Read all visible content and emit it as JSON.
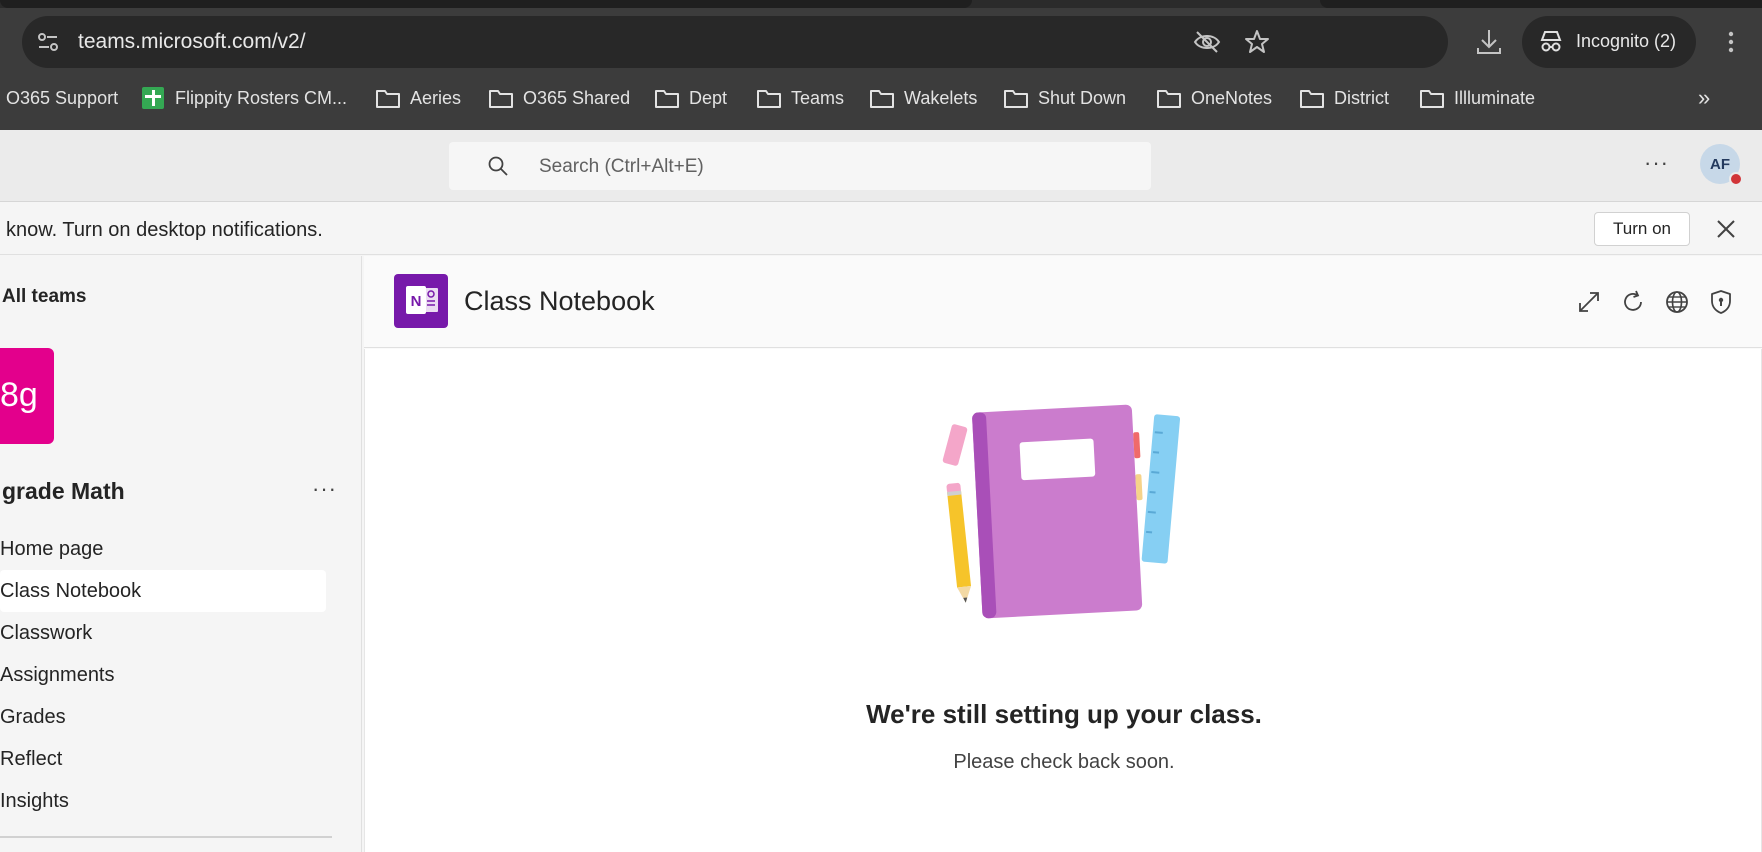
{
  "browser": {
    "url": "teams.microsoft.com/v2/",
    "incognito_label": "Incognito (2)",
    "bookmarks": [
      {
        "label": "O365 Support",
        "icon": "none"
      },
      {
        "label": "Flippity Rosters CM...",
        "icon": "sheets-icon"
      },
      {
        "label": "Aeries",
        "icon": "folder-icon"
      },
      {
        "label": "O365 Shared",
        "icon": "folder-icon"
      },
      {
        "label": "Dept",
        "icon": "folder-icon"
      },
      {
        "label": "Teams",
        "icon": "folder-icon"
      },
      {
        "label": "Wakelets",
        "icon": "folder-icon"
      },
      {
        "label": "Shut Down",
        "icon": "folder-icon"
      },
      {
        "label": "OneNotes",
        "icon": "folder-icon"
      },
      {
        "label": "District",
        "icon": "folder-icon"
      },
      {
        "label": "Illluminate",
        "icon": "folder-icon"
      }
    ],
    "overflow_label": "»"
  },
  "teams_header": {
    "search_placeholder": "Search (Ctrl+Alt+E)",
    "more_label": "···",
    "avatar_initials": "AF"
  },
  "banner": {
    "text": "know. Turn on desktop notifications.",
    "turn_on_label": "Turn on"
  },
  "left_pane": {
    "all_teams_label": "All teams",
    "team_tile_text": "8g",
    "team_name": "grade Math",
    "team_more_label": "···",
    "nav": [
      {
        "label": "Home page",
        "selected": false
      },
      {
        "label": "Class Notebook",
        "selected": true
      },
      {
        "label": "Classwork",
        "selected": false
      },
      {
        "label": "Assignments",
        "selected": false
      },
      {
        "label": "Grades",
        "selected": false
      },
      {
        "label": "Reflect",
        "selected": false
      },
      {
        "label": "Insights",
        "selected": false
      }
    ]
  },
  "main": {
    "app_title": "Class Notebook",
    "logo_letter": "N",
    "message_title": "We're still setting up your class.",
    "message_subtitle": "Please check back soon."
  },
  "colors": {
    "chrome_bg": "#3c3c3c",
    "team_tile": "#e3008c",
    "onenote": "#7719aa",
    "presence_busy": "#d13438"
  }
}
